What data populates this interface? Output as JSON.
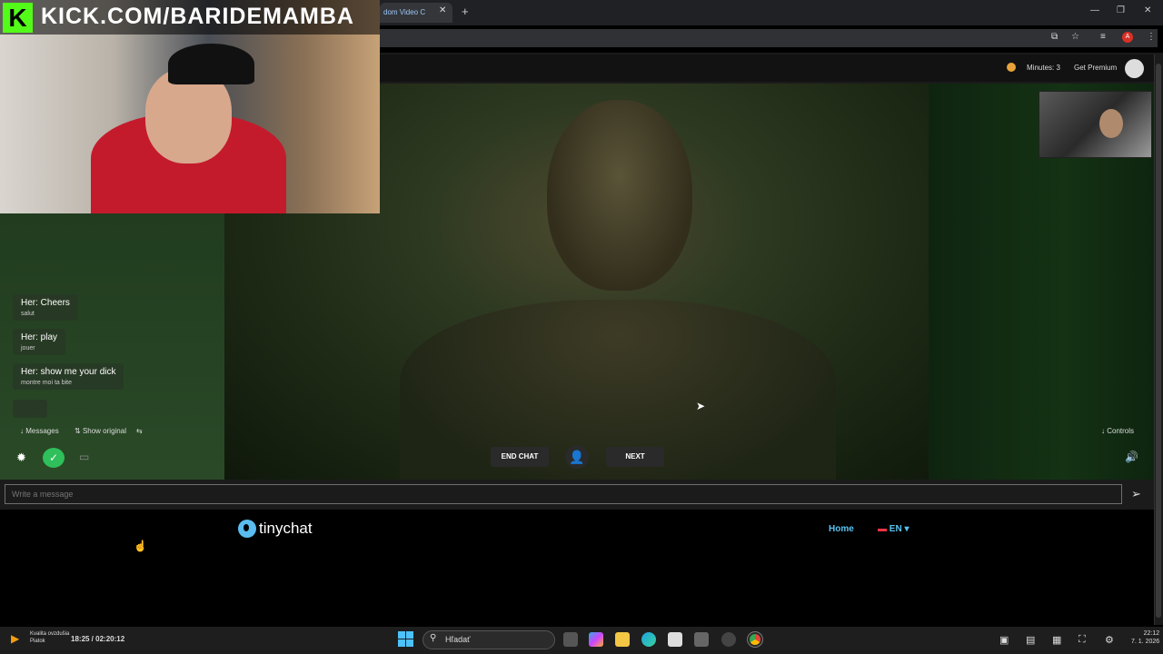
{
  "browser": {
    "tab_title": "dom Video C",
    "tab_close": "✕",
    "new_tab": "+",
    "window_controls": [
      "—",
      "❐",
      "✕"
    ],
    "profile_initial": "A"
  },
  "stream_overlay": {
    "kick_logo": "K",
    "channel_url": "KICK.COM/BARIDEMAMBA"
  },
  "header": {
    "minutes": "Minutes: 3",
    "premium": "Get Premium"
  },
  "chat": {
    "messages": [
      {
        "text": "Her: Cheers",
        "translation": "salut"
      },
      {
        "text": "Her: play",
        "translation": "jouer"
      },
      {
        "text": "Her: show me your dick",
        "translation": "montre moi ta bite"
      }
    ],
    "messages_label": "Messages",
    "show_original_label": "Show original",
    "controls_label": "Controls"
  },
  "controls": {
    "end_chat": "END CHAT",
    "next": "NEXT"
  },
  "message_input": {
    "placeholder": "Write a message"
  },
  "footer": {
    "logo_text": "tinychat",
    "home": "Home",
    "language": "EN"
  },
  "taskbar": {
    "search_placeholder": "Hľadať",
    "weather_line1": "Kvalita ovzdušia",
    "weather_line2": "Piatok",
    "media_time": "18:25 / 02:20:12",
    "clock_time": "22:12",
    "clock_date": "7. 1. 2026"
  },
  "colors": {
    "kick_green": "#53fc18",
    "accent_blue": "#59c3f2",
    "ok_green": "#2fbf5b"
  }
}
